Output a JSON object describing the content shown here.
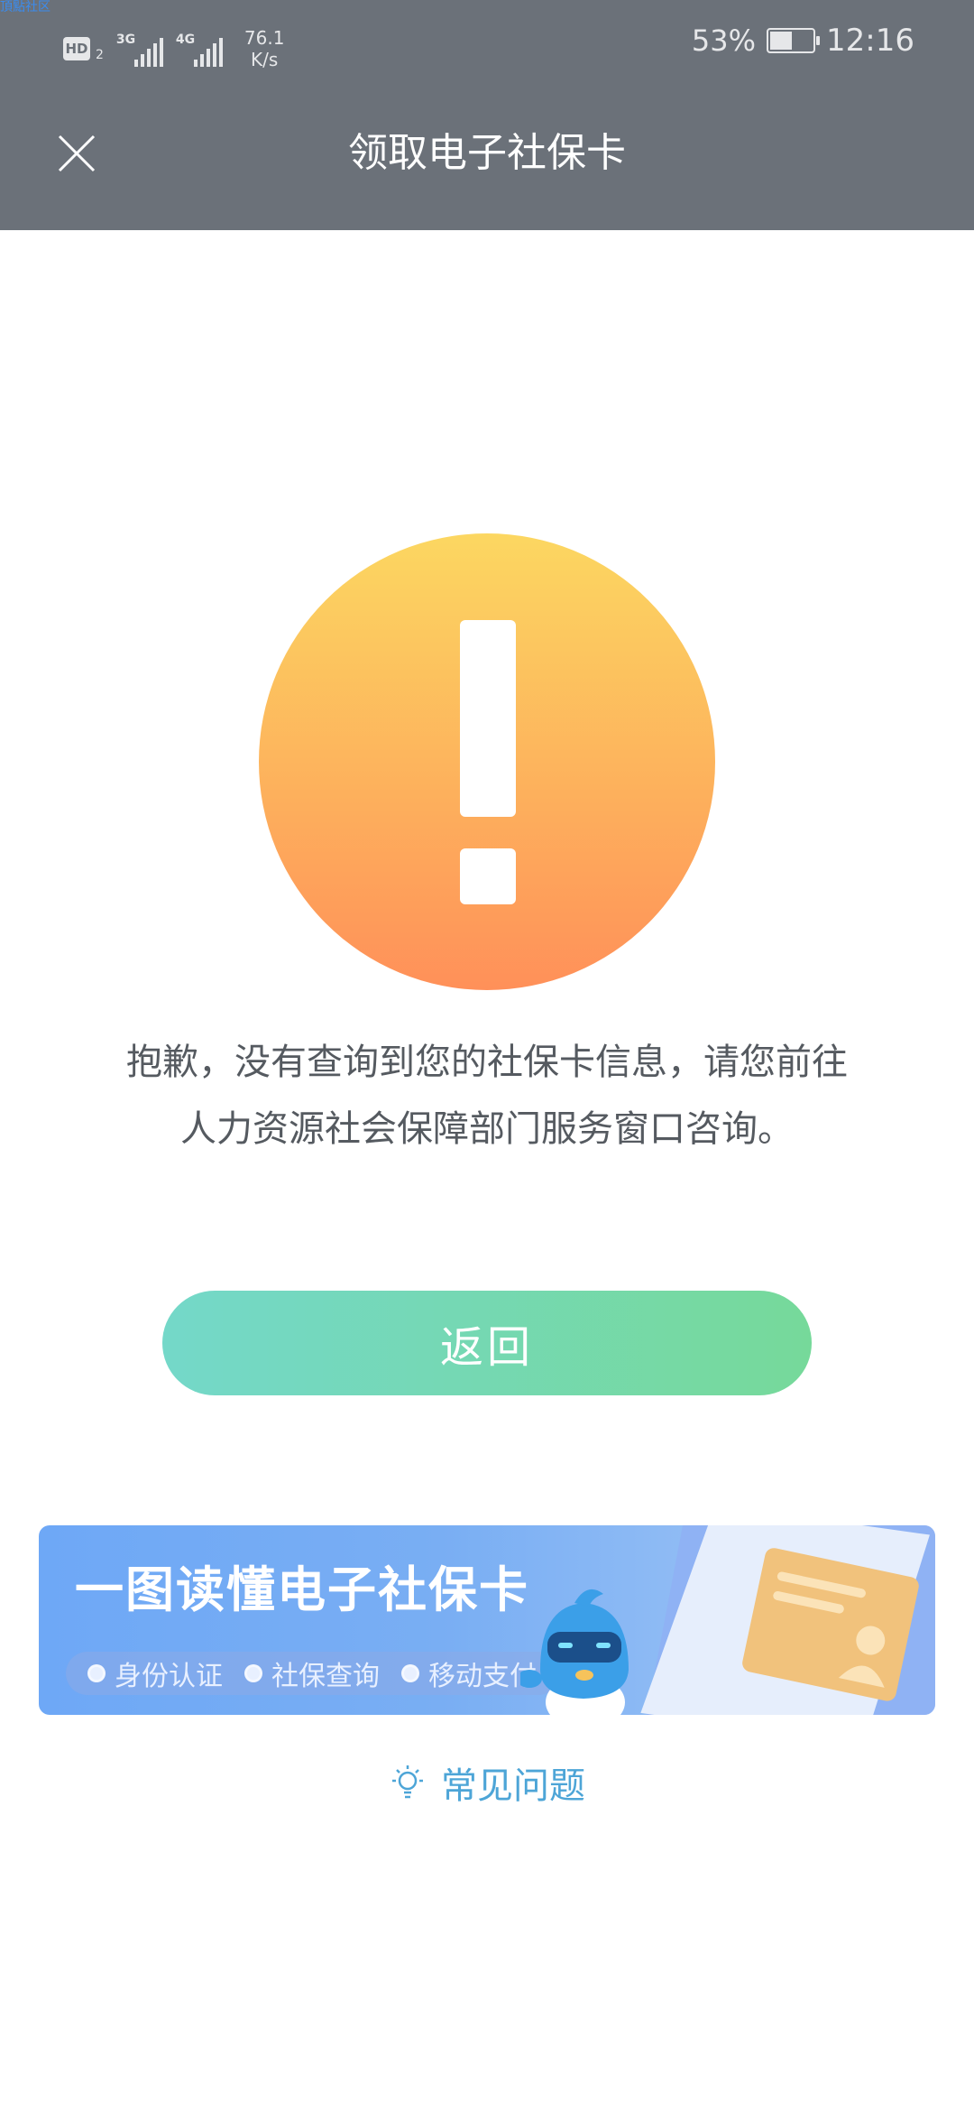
{
  "watermark": "頂點社区",
  "status_bar": {
    "hd_label": "HD",
    "hd_sub": "2",
    "signal1_label": "3G",
    "signal2_label": "4G",
    "speed_value": "76.1",
    "speed_unit": "K/s",
    "battery_percent": "53%",
    "battery_level": 0.53,
    "time": "12:16"
  },
  "nav": {
    "title": "领取电子社保卡",
    "close_icon": "close-icon"
  },
  "error": {
    "icon": "exclamation-icon",
    "message_line1": "抱歉，没有查询到您的社保卡信息，请您前往",
    "message_line2": "人力资源社会保障部门服务窗口咨询。"
  },
  "back_button": {
    "label": "返回"
  },
  "banner": {
    "title": "一图读懂电子社保卡",
    "tags": [
      "身份认证",
      "社保查询",
      "移动支付"
    ]
  },
  "faq": {
    "icon": "lightbulb-icon",
    "label": "常见问题"
  },
  "colors": {
    "header": "#6b7179",
    "warning_top": "#fcd761",
    "warning_bottom": "#ff9059",
    "button_left": "#74d8c9",
    "button_right": "#76d99a",
    "faq": "#4da5d7",
    "banner": "#6ea8f6"
  }
}
